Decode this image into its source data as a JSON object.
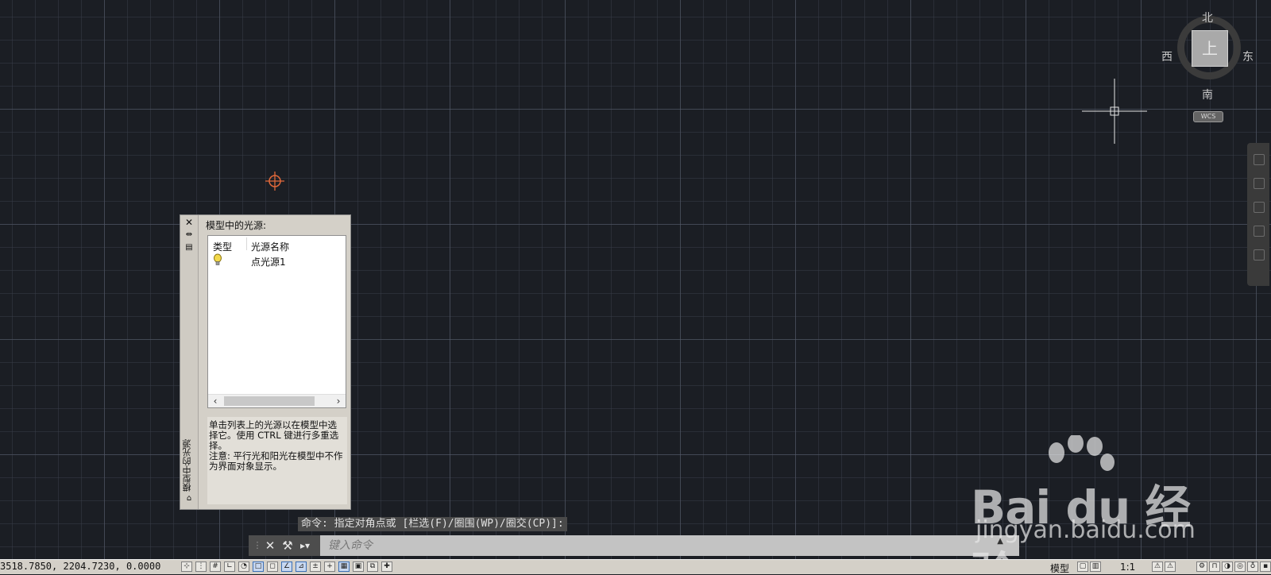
{
  "viewcube": {
    "north": "北",
    "south": "南",
    "east": "东",
    "west": "西",
    "face": "上",
    "wcs": "WCS"
  },
  "palette": {
    "vertical_title": "模型中的光源",
    "heading": "模型中的光源:",
    "columns": [
      "类型",
      "光源名称"
    ],
    "rows": [
      {
        "type_icon": "light-bulb-icon",
        "name": "点光源1"
      }
    ],
    "help_text_1": "单击列表上的光源以在模型中选择它。使用 CTRL 键进行多重选择。",
    "help_text_2": "注意: 平行光和阳光在模型中不作为界面对象显示。"
  },
  "command": {
    "history": "命令: 指定对角点或 [栏选(F)/圈围(WP)/圈交(CP)]:",
    "placeholder": "键入命令"
  },
  "statusbar": {
    "coords": "3518.7850, 2204.7230, 0.0000",
    "model": "模型",
    "scale": "1:1"
  },
  "watermark": {
    "brand": "Bai du 经验",
    "url": "jingyan.baidu.com"
  },
  "colors": {
    "background": "#1b1e24",
    "light_glyph": "#e0683a",
    "palette": "#d4d0c8"
  }
}
